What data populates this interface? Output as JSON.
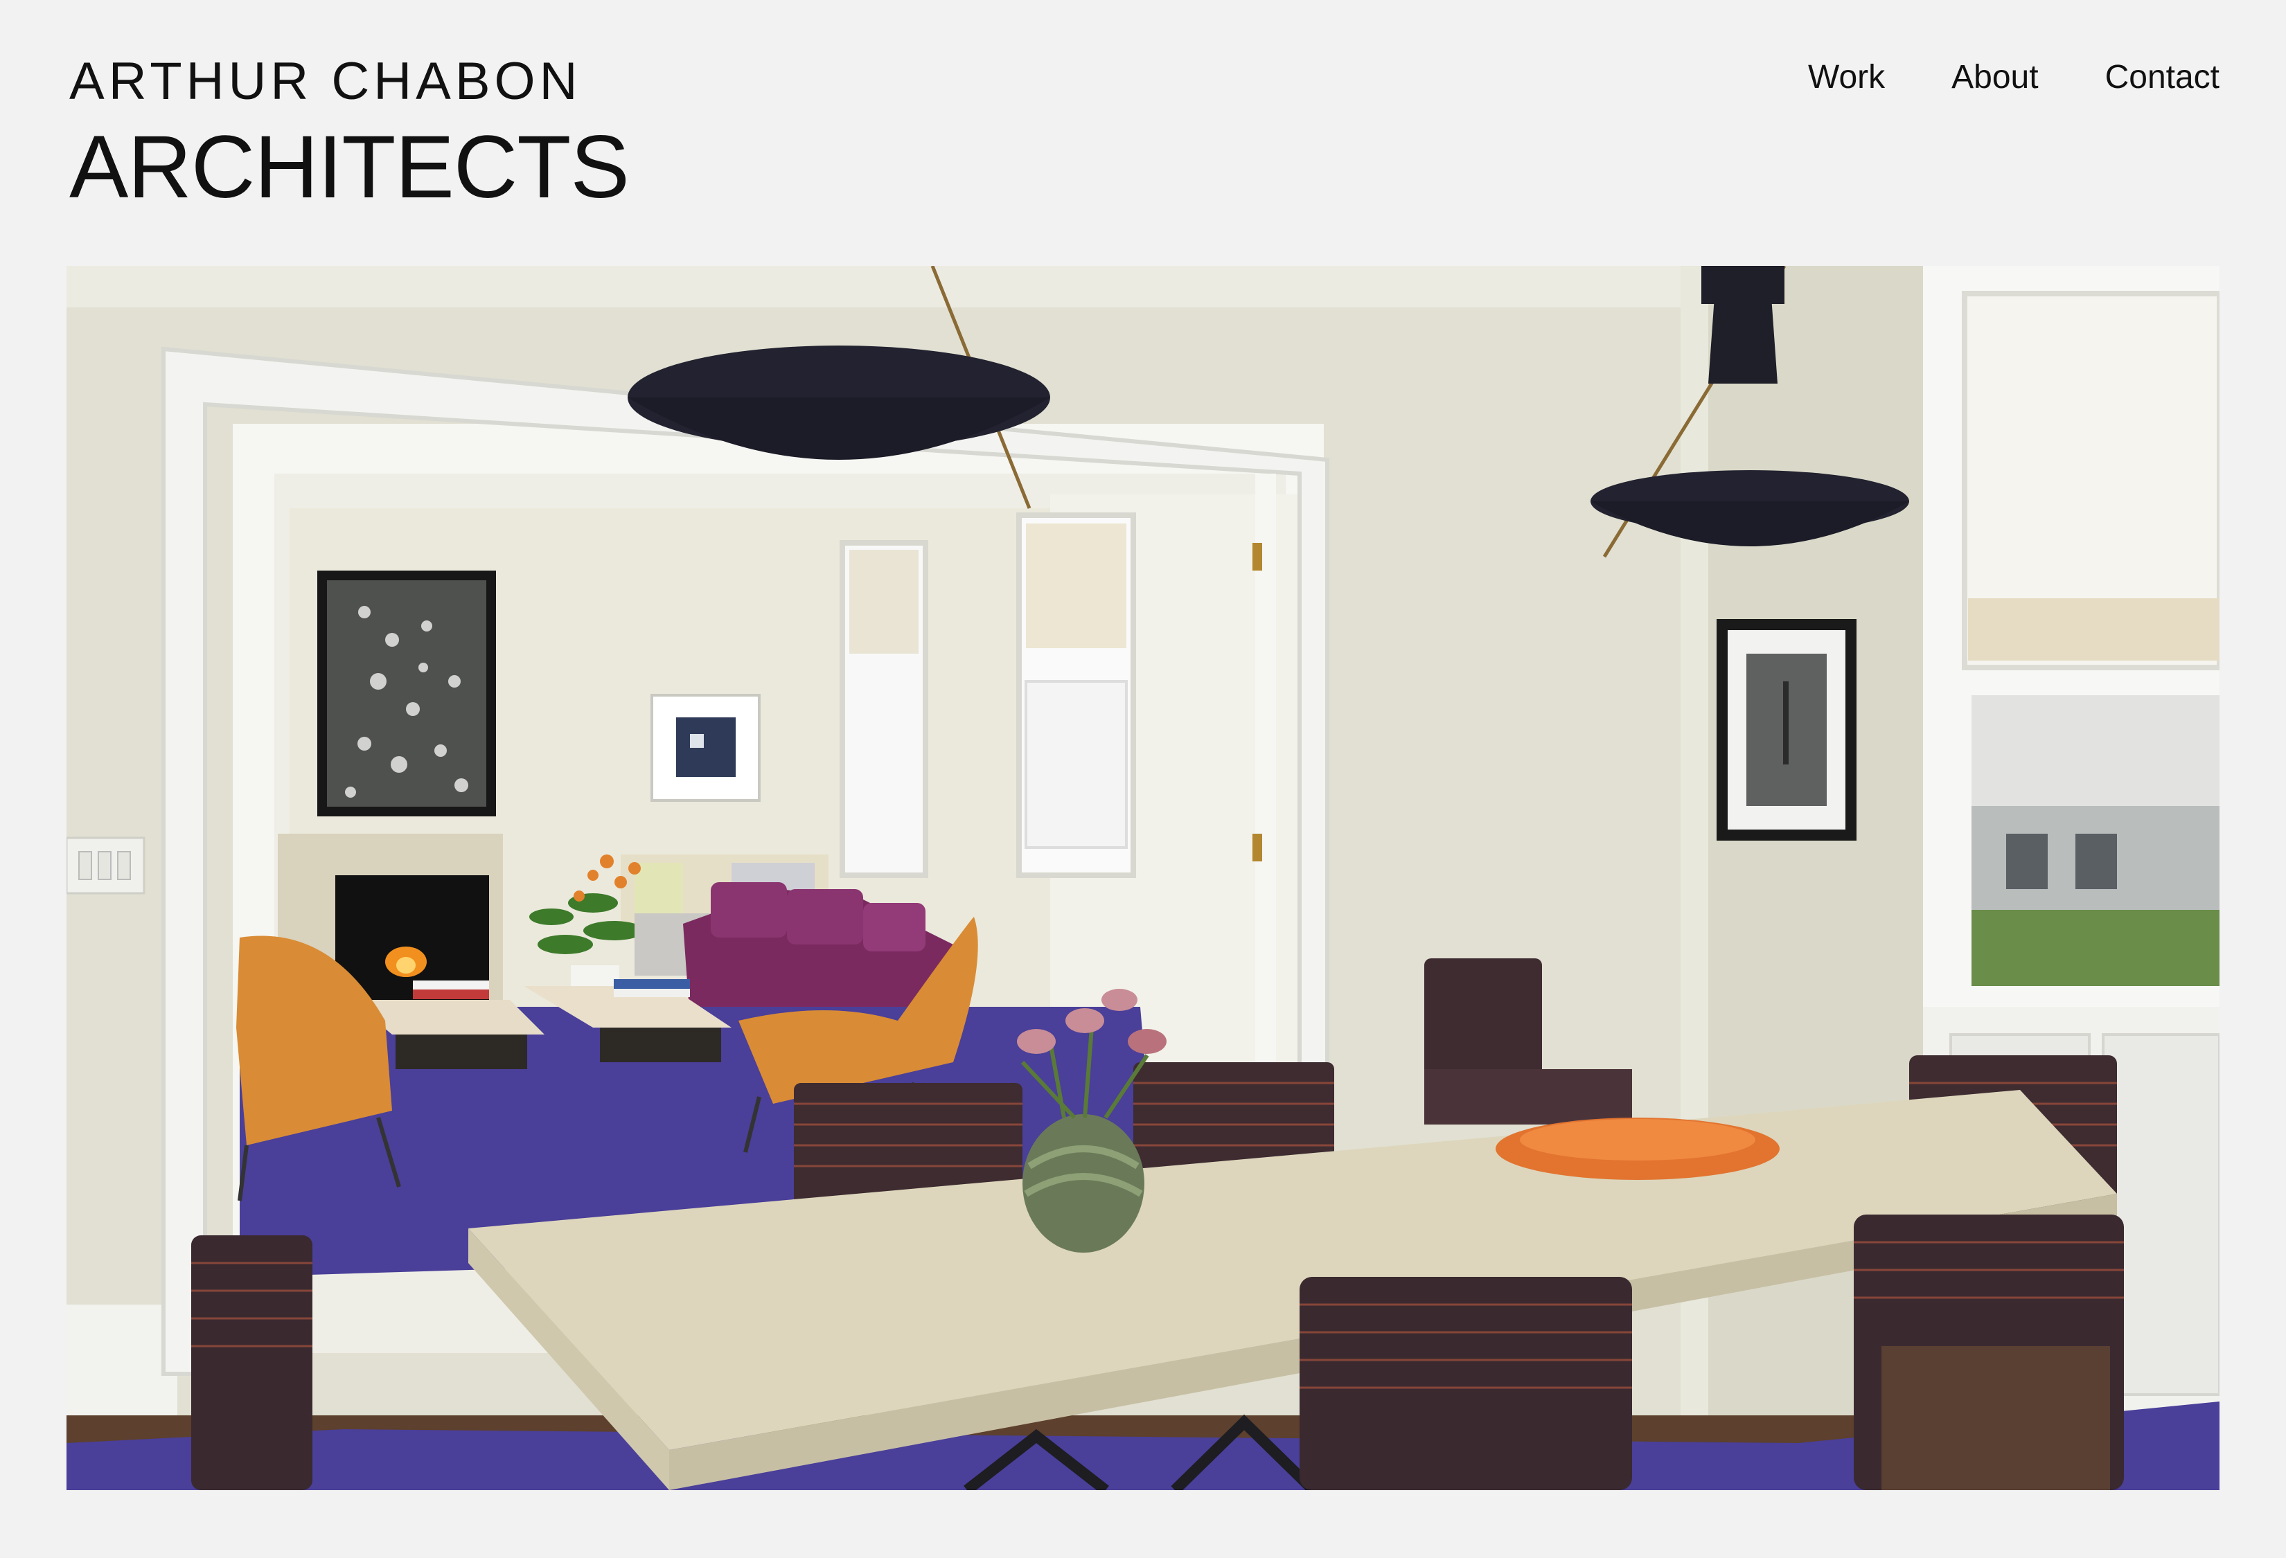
{
  "brand": {
    "line1": "ARTHUR CHABON",
    "line2": "ARCHITECTS"
  },
  "nav": {
    "items": [
      {
        "label": "Work"
      },
      {
        "label": "About"
      },
      {
        "label": "Contact"
      }
    ]
  },
  "hero": {
    "subject": "dining-room-photo",
    "colors": {
      "wall": "#e3e2d5",
      "trim": "#f4f4f0",
      "rug": "#4a3f99",
      "table": "#ddd6bd",
      "chair": "#3a2a30",
      "armchair": "#d78b35",
      "sofa": "#7a2a5e",
      "lamp": "#232330",
      "tray": "#e87a35",
      "floor": "#5a3e2c"
    }
  }
}
